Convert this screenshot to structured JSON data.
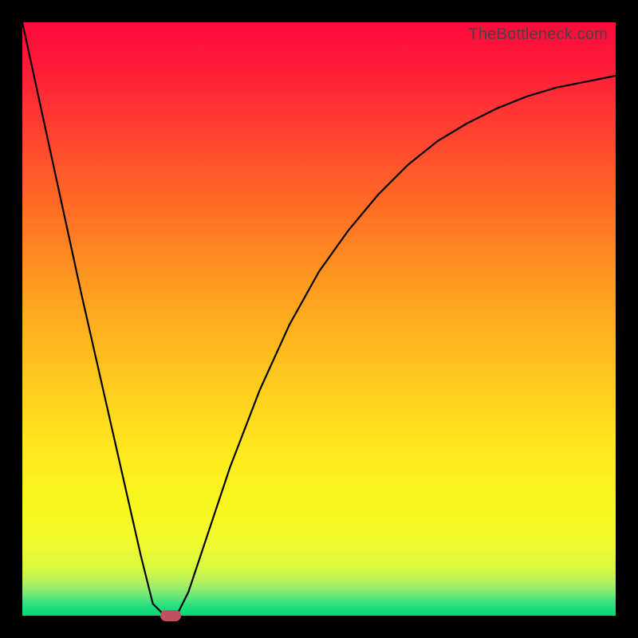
{
  "watermark": "TheBottleneck.com",
  "colors": {
    "frame": "#000000",
    "curve": "#000000",
    "marker": "#c05060",
    "gradient_stops": [
      {
        "pos": 0.0,
        "hex": "#ff0a3a"
      },
      {
        "pos": 0.46,
        "hex": "#ffa020"
      },
      {
        "pos": 0.82,
        "hex": "#f8f81e"
      },
      {
        "pos": 1.0,
        "hex": "#00d878"
      }
    ]
  },
  "chart_data": {
    "type": "line",
    "title": "",
    "xlabel": "",
    "ylabel": "",
    "xlim": [
      0,
      100
    ],
    "ylim": [
      0,
      100
    ],
    "x": [
      0,
      5,
      10,
      15,
      20,
      22,
      24,
      25,
      26,
      28,
      30,
      35,
      40,
      45,
      50,
      55,
      60,
      65,
      70,
      75,
      80,
      85,
      90,
      95,
      100
    ],
    "values": [
      100,
      77,
      54,
      32,
      10,
      2,
      0,
      0,
      0,
      4,
      10,
      25,
      38,
      49,
      58,
      65,
      71,
      76,
      80,
      83,
      85.5,
      87.5,
      89,
      90,
      91
    ],
    "optimum_marker": {
      "x": 25,
      "y": 0
    }
  }
}
